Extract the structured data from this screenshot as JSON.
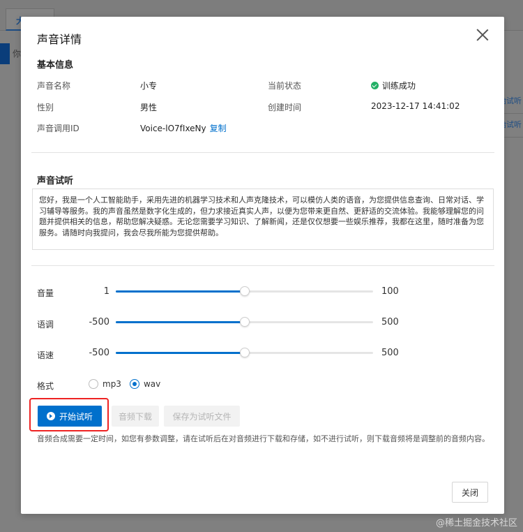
{
  "background": {
    "tab_label": "大",
    "left_text": "你",
    "row_links": [
      "始试听",
      "始试听"
    ]
  },
  "dialog": {
    "title": "声音详情",
    "basic_info": {
      "section_title": "基本信息",
      "fields": {
        "name_label": "声音名称",
        "name_value": "小专",
        "status_label": "当前状态",
        "status_value": "训练成功",
        "gender_label": "性别",
        "gender_value": "男性",
        "created_label": "创建时间",
        "created_value": "2023-12-17 14:41:02",
        "voice_id_label": "声音调用ID",
        "voice_id_value": "Voice-lO7fIxeNy",
        "copy_label": "复制"
      }
    },
    "preview": {
      "section_title": "声音试听",
      "sample_text": "您好，我是一个人工智能助手，采用先进的机器学习技术和人声克隆技术，可以模仿人类的语音，为您提供信息查询、日常对话、学习辅导等服务。我的声音虽然是数字化生成的，但力求接近真实人声，以便为您带来更自然、更舒适的交流体验。我能够理解您的问题并提供相关的信息，帮助您解决疑惑。无论您需要学习知识、了解新闻，还是仅仅想要一些娱乐推荐，我都在这里，随时准备为您服务。请随时向我提问，我会尽我所能为您提供帮助。"
    },
    "sliders": [
      {
        "label": "音量",
        "min": "1",
        "max": "100",
        "value_fraction": 0.5
      },
      {
        "label": "语调",
        "min": "-500",
        "max": "500",
        "value_fraction": 0.5
      },
      {
        "label": "语速",
        "min": "-500",
        "max": "500",
        "value_fraction": 0.5
      }
    ],
    "format": {
      "label": "格式",
      "options": [
        "mp3",
        "wav"
      ],
      "selected": "wav"
    },
    "buttons": {
      "start_preview": "开始试听",
      "download_audio": "音频下载",
      "save_preview_file": "保存为试听文件",
      "close": "关闭"
    },
    "note": "音频合成需要一定时间，如您有参数调整，请在试听后在对音频进行下载和存储，如不进行试听，则下载音频将是调整前的音频内容。"
  },
  "watermark": "@稀土掘金技术社区",
  "colors": {
    "primary": "#0070cc",
    "success": "#23b066",
    "highlight": "#e22222"
  }
}
